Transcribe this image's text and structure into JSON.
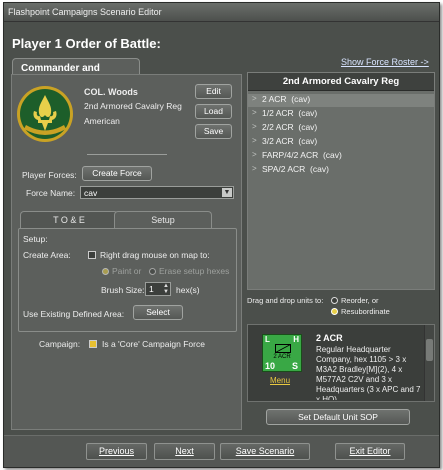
{
  "window": {
    "title": "Flashpoint Campaigns Scenario Editor"
  },
  "heading": "Player 1 Order of Battle:",
  "show_roster_link": "Show Force Roster ->",
  "commander_tab": "Commander and Forces",
  "commander": {
    "name": "COL. Woods",
    "unit": "2nd Armored Cavalry Reg",
    "nationality": "American",
    "emblem_text": "TOUJOURS PRET",
    "buttons": {
      "edit": "Edit",
      "load": "Load",
      "save": "Save"
    }
  },
  "player_forces": {
    "label": "Player Forces:",
    "create_button": "Create Force"
  },
  "force_name": {
    "label": "Force Name:",
    "value": "cav"
  },
  "subtabs": [
    "T O & E",
    "Setup"
  ],
  "setup": {
    "group_label": "Setup:",
    "create_area_label": "Create Area:",
    "right_drag_label": "Right drag mouse on map to:",
    "paint_label": "Paint or",
    "erase_label": "Erase setup hexes",
    "brush_label": "Brush Size:",
    "brush_value": "1",
    "brush_unit": "hex(s)",
    "use_existing_label": "Use Existing Defined Area:",
    "select_button": "Select"
  },
  "campaign": {
    "label": "Campaign:",
    "checkbox_label": "Is a 'Core' Campaign Force"
  },
  "orbat": {
    "header": "2nd Armored Cavalry Reg",
    "rows": [
      "2 ACR  (cav)",
      "1/2 ACR  (cav)",
      "2/2 ACR  (cav)",
      "3/2 ACR  (cav)",
      "FARP/4/2 ACR  (cav)",
      "SPA/2 ACR  (cav)"
    ]
  },
  "drag_drop": {
    "label": "Drag and drop units to:",
    "reorder": "Reorder, or",
    "resubordinate": "Resubordinate"
  },
  "unit_info": {
    "counter_top_left": "L",
    "counter_top_right": "H",
    "counter_label": "2 ACR",
    "counter_bottom_left": "10",
    "counter_bottom_right": "S",
    "menu_link": "Menu",
    "title": "2 ACR",
    "description": "Regular Headquarter Company, hex 1105 > 3 x M3A2 Bradley[M](2), 4 x M577A2 C2V and 3 x Headquarters (3 x APC and 7 x HQ)"
  },
  "set_default_sop": "Set Default Unit SOP",
  "bottom": {
    "previous": "Previous",
    "next": "Next",
    "save_scenario": "Save Scenario",
    "exit_editor": "Exit Editor"
  },
  "colors": {
    "background": "#4b4f4b",
    "panel": "#5c5f5c",
    "orbat_selected": "#7e827e",
    "radio_on": "#e8d048"
  }
}
